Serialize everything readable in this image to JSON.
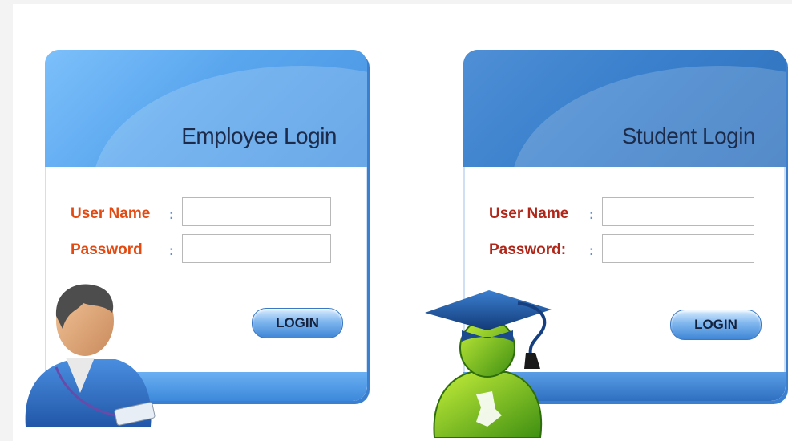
{
  "employee": {
    "title": "Employee Login",
    "username_label": "User Name",
    "password_label": "Password",
    "colon": ":",
    "username_value": "",
    "password_value": "",
    "login_label": "LOGIN"
  },
  "student": {
    "title": "Student Login",
    "username_label": "User Name",
    "password_label": "Password:",
    "colon": ":",
    "username_value": "",
    "password_value": "",
    "login_label": "LOGIN"
  },
  "colors": {
    "employee_header": "#5aa6ee",
    "student_header": "#3a80cc",
    "employee_label": "#e34a12",
    "student_label": "#b0271a"
  },
  "icons": {
    "employee_avatar": "employee-person-icon",
    "student_avatar": "graduate-student-icon"
  }
}
